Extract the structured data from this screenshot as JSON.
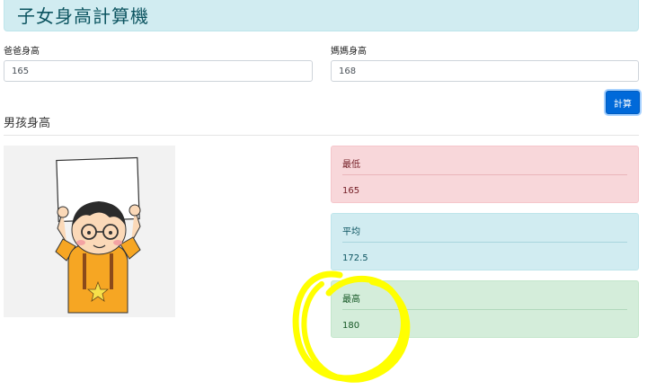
{
  "header": {
    "title": "子女身高計算機",
    "bg_color": "#d1ecf1"
  },
  "form": {
    "father": {
      "label": "爸爸身高",
      "value": "165"
    },
    "mother": {
      "label": "媽媽身高",
      "value": "168"
    },
    "calculate_label": "計算"
  },
  "result": {
    "section_title": "男孩身高",
    "image": {
      "icon": "boy-holding-sign-illustration"
    },
    "min": {
      "label": "最低",
      "value": "165",
      "color": "#f8d7da"
    },
    "avg": {
      "label": "平均",
      "value": "172.5",
      "color": "#d1ecf1"
    },
    "max": {
      "label": "最高",
      "value": "180",
      "color": "#d4edda"
    }
  },
  "annotation": {
    "color": "#ffff00",
    "icon": "yellow-circle-scribble"
  }
}
